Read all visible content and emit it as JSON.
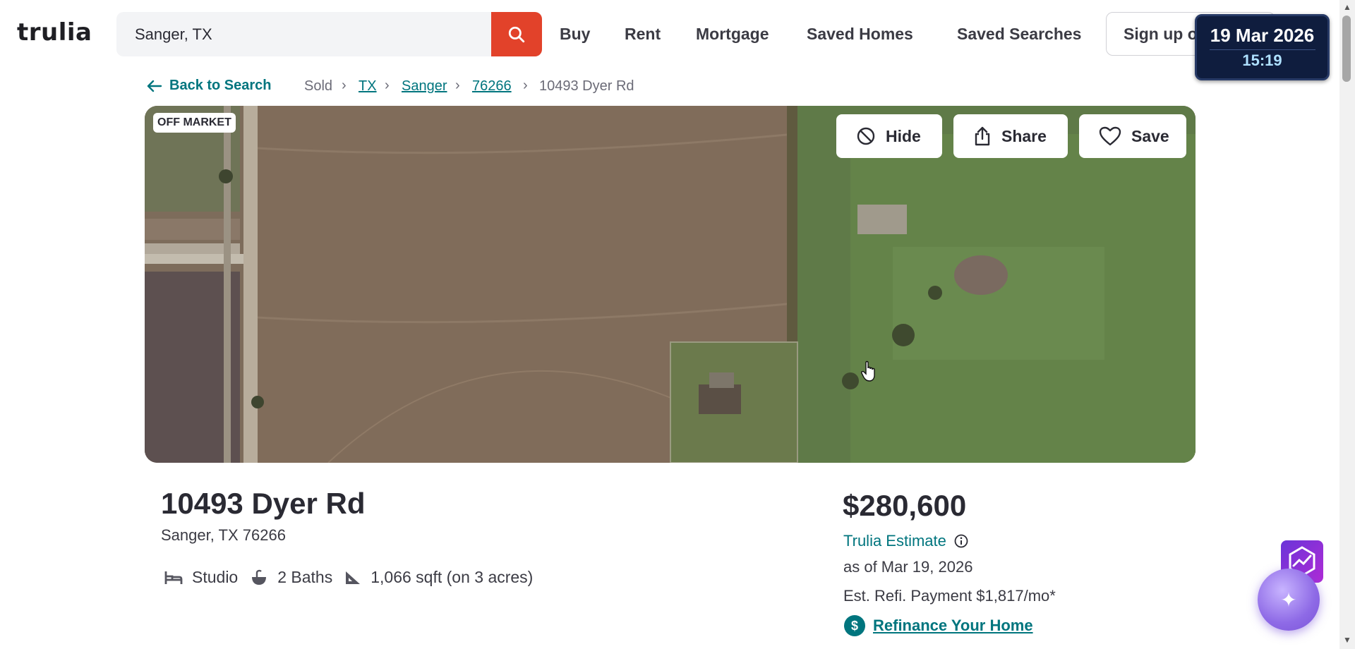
{
  "header": {
    "logo": "trulia",
    "search_value": "Sanger, TX",
    "nav": [
      "Buy",
      "Rent",
      "Mortgage",
      "Saved Homes",
      "Saved Searches"
    ],
    "signup_label": "Sign up or"
  },
  "clock": {
    "date": "19 Mar 2026",
    "time": "15:19"
  },
  "breadcrumb": {
    "back_label": "Back to Search",
    "items": [
      "Sold",
      "TX",
      "Sanger",
      "76266",
      "10493 Dyer Rd"
    ]
  },
  "hero": {
    "badge": "OFF MARKET",
    "hide_label": "Hide",
    "share_label": "Share",
    "save_label": "Save"
  },
  "property": {
    "address": "10493 Dyer Rd",
    "city_line": "Sanger, TX 76266",
    "beds": "Studio",
    "baths": "2 Baths",
    "area": "1,066 sqft (on 3 acres)"
  },
  "pricing": {
    "price": "$280,600",
    "estimate_label": "Trulia Estimate",
    "as_of": "as of Mar 19, 2026",
    "refi_payment": "Est. Refi. Payment $1,817/mo*",
    "refi_link": "Refinance Your Home"
  },
  "colors": {
    "accent": "#00757e",
    "search_button": "#e2422a",
    "text": "#2a2a33"
  }
}
